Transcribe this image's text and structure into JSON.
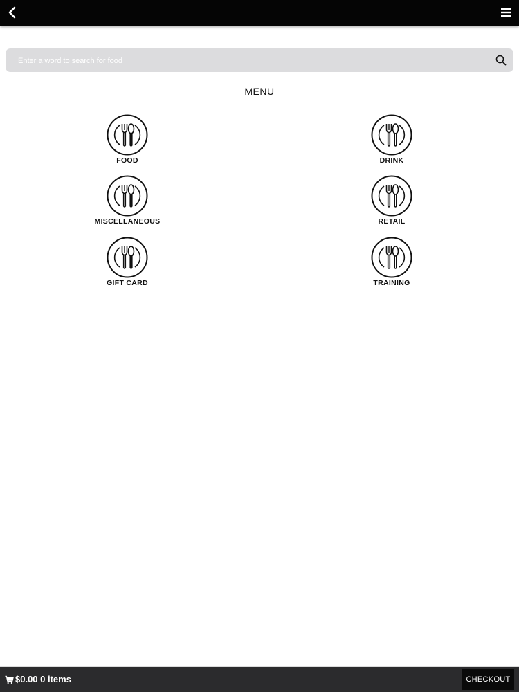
{
  "header": {
    "back_icon": "chevron-left-icon",
    "menu_icon": "hamburger-icon",
    "bar_color": "#050505"
  },
  "search": {
    "placeholder": "Enter a word to search for food",
    "value": "",
    "icon": "search-icon"
  },
  "menu": {
    "title": "MENU",
    "categories": [
      {
        "label": "FOOD",
        "icon": "plate-fork-spoon-icon"
      },
      {
        "label": "DRINK",
        "icon": "plate-fork-spoon-icon"
      },
      {
        "label": "MISCELLANEOUS",
        "icon": "plate-fork-spoon-icon"
      },
      {
        "label": "RETAIL",
        "icon": "plate-fork-spoon-icon"
      },
      {
        "label": "GIFT CARD",
        "icon": "plate-fork-spoon-icon"
      },
      {
        "label": "TRAINING",
        "icon": "plate-fork-spoon-icon"
      }
    ]
  },
  "cart": {
    "icon": "shopping-cart-icon",
    "summary": "$0.00 0 items",
    "checkout_label": "CHECKOUT",
    "bar_color": "#2b2b2d"
  }
}
